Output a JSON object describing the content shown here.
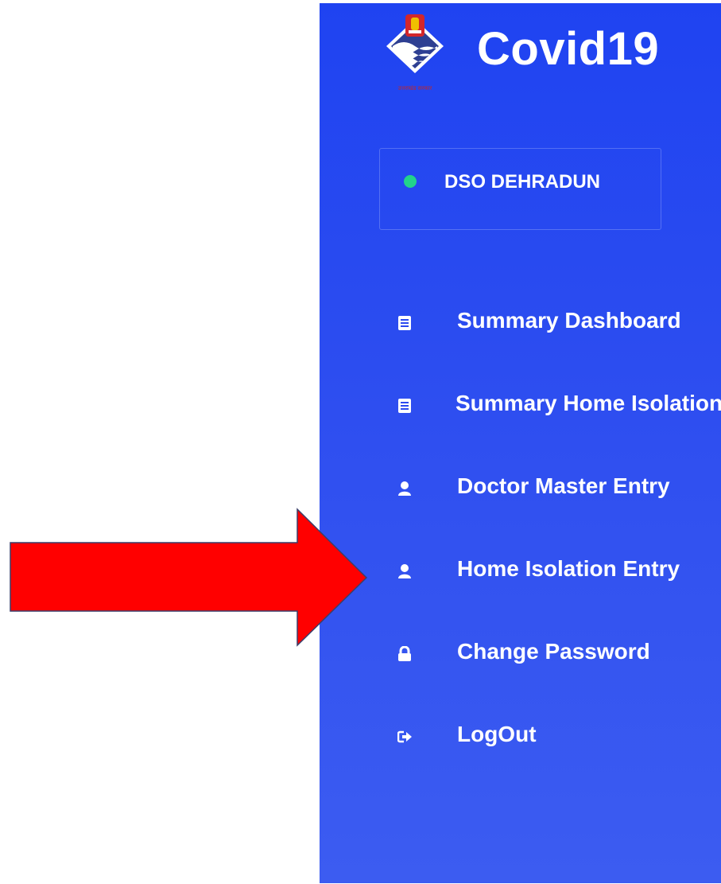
{
  "app": {
    "title": "Covid19",
    "logo_icon": "uttarakhand-emblem-icon",
    "logo_caption": "उत्तराखंड सरकार"
  },
  "user": {
    "name": "DSO DEHRADUN",
    "status_color": "#22d38b"
  },
  "menu": {
    "items": [
      {
        "label": "Summary Dashboard",
        "icon": "document-list-icon"
      },
      {
        "label": "Summary Home Isolation",
        "icon": "document-list-icon"
      },
      {
        "label": "Doctor Master Entry",
        "icon": "user-icon"
      },
      {
        "label": "Home Isolation Entry",
        "icon": "user-icon"
      },
      {
        "label": "Change Password",
        "icon": "lock-icon"
      },
      {
        "label": "LogOut",
        "icon": "logout-icon"
      }
    ]
  },
  "annotation": {
    "color": "#ff0000",
    "icon": "red-arrow-pointer"
  },
  "colors": {
    "sidebar_top": "#1f43f1",
    "sidebar_bottom": "#3c5cf1",
    "text": "#ffffff"
  }
}
